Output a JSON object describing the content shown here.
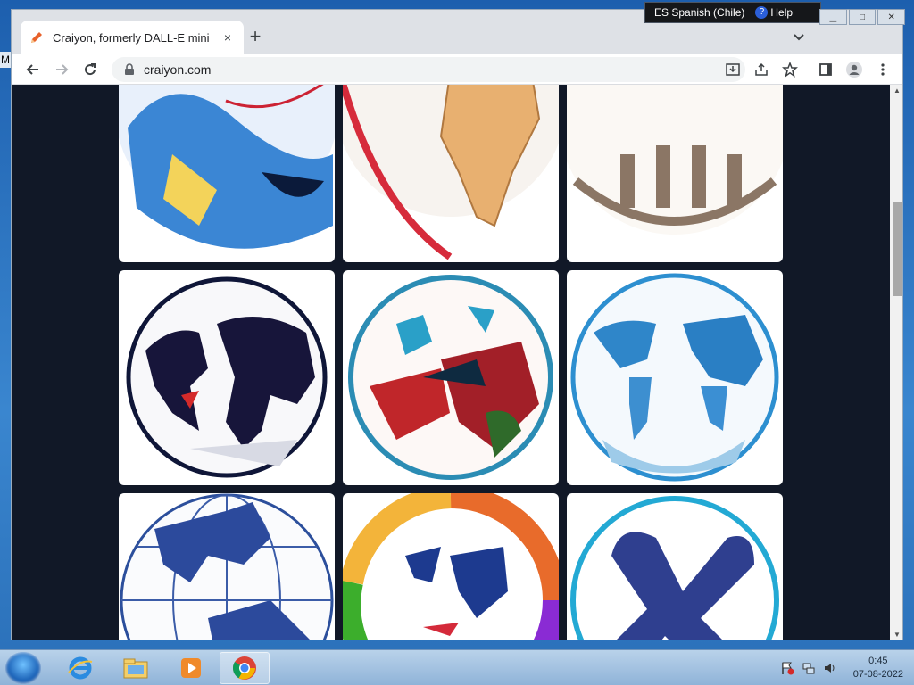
{
  "desktop": {
    "left_edge_text": "M"
  },
  "language_bar": {
    "language": "ES Spanish (Chile)",
    "help_label": "Help",
    "help_icon": "?"
  },
  "browser": {
    "tab": {
      "title": "Craiyon, formerly DALL-E mini",
      "favicon": "pencil-icon",
      "close": "×"
    },
    "new_tab": "+",
    "url": "craiyon.com"
  },
  "window_controls": {
    "minimize": "▁",
    "maximize": "□",
    "close": "✕"
  },
  "gallery": {
    "images": [
      {
        "name": "globe-blue-yellow"
      },
      {
        "name": "globe-africa-map"
      },
      {
        "name": "globe-letters"
      },
      {
        "name": "globe-dark-continents"
      },
      {
        "name": "globe-red-teal"
      },
      {
        "name": "globe-light-blue-map"
      },
      {
        "name": "globe-grid-blue"
      },
      {
        "name": "globe-rainbow-ring"
      },
      {
        "name": "globe-blue-emblem"
      }
    ]
  },
  "taskbar": {
    "apps": [
      {
        "name": "internet-explorer-icon"
      },
      {
        "name": "file-explorer-icon"
      },
      {
        "name": "media-player-icon"
      },
      {
        "name": "chrome-icon"
      }
    ],
    "time": "0:45",
    "date": "07-08-2022"
  }
}
